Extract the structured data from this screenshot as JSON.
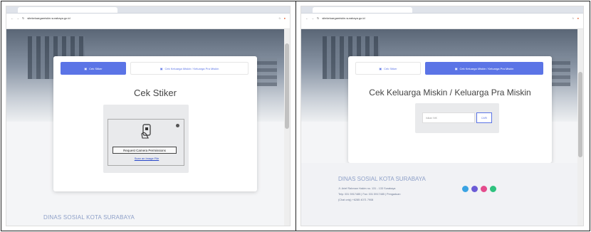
{
  "browser": {
    "url": "sitekeluargamiskin.surabaya.go.id",
    "bookmarks": [
      "",
      "",
      "",
      "",
      "",
      "",
      ""
    ]
  },
  "left": {
    "tab_active_label": "Cek Stiker",
    "tab_inactive_label": "Cek Keluarga Miskin / Keluarga Pra Miskin",
    "heading": "Cek Stiker",
    "request_button": "Request Camera Permissions",
    "scan_link": "Scan an Image File",
    "footer_title": "DINAS SOSIAL KOTA SURABAYA"
  },
  "right": {
    "tab_inactive_label": "Cek Stiker",
    "tab_active_label": "Cek Keluarga Miskin / Keluarga Pra Miskin",
    "heading": "Cek Keluarga Miskin / Keluarga Pra Miskin",
    "search_placeholder": "Isikan NIK",
    "search_button": "CARI",
    "footer_title": "DINAS SOSIAL KOTA SURABAYA",
    "address": "Jl. Arief Rahman Hakim no. 131 - 133 Surabaya",
    "contact": "Telp: 031 5917485 | Fax: 031 5917485 | Pengaduan",
    "chat": "(Chat only) +6285 4071 7908"
  },
  "colors": {
    "accent": "#5b74e6",
    "footer_text": "#8ea0c8",
    "social": [
      "#3aa3e3",
      "#6b5bd6",
      "#e44b8c",
      "#2ec27e"
    ]
  }
}
